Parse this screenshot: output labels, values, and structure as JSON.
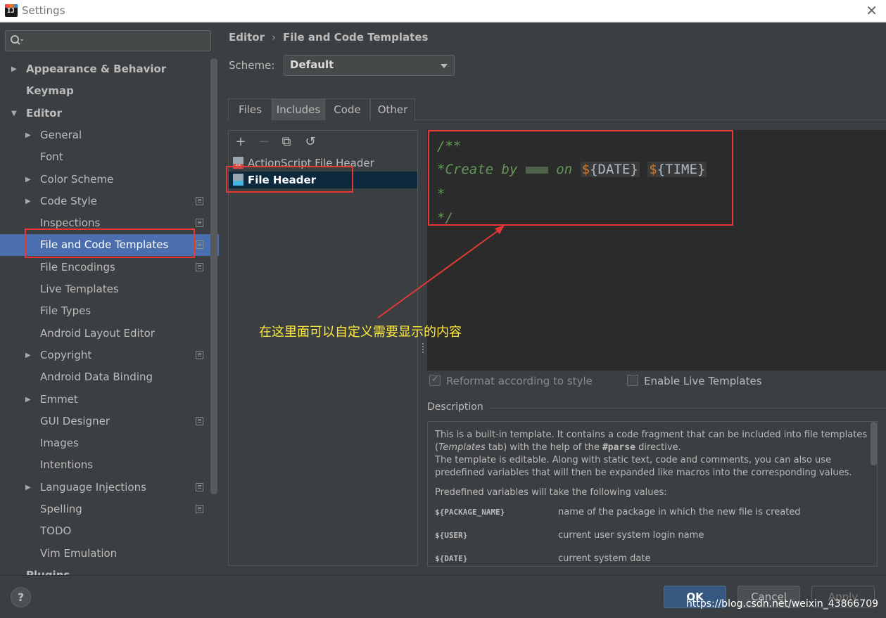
{
  "window": {
    "title": "Settings",
    "close": "✕"
  },
  "sidebar": {
    "search_placeholder": "",
    "items": [
      {
        "label": "Appearance & Behavior",
        "level": 0,
        "bold": true,
        "arrow": "▶"
      },
      {
        "label": "Keymap",
        "level": 0,
        "bold": true,
        "arrow": ""
      },
      {
        "label": "Editor",
        "level": 0,
        "bold": true,
        "arrow": "▼"
      },
      {
        "label": "General",
        "level": 1,
        "arrow": "▶"
      },
      {
        "label": "Font",
        "level": 1,
        "arrow": ""
      },
      {
        "label": "Color Scheme",
        "level": 1,
        "arrow": "▶"
      },
      {
        "label": "Code Style",
        "level": 1,
        "arrow": "▶",
        "project": true
      },
      {
        "label": "Inspections",
        "level": 1,
        "arrow": "",
        "project": true
      },
      {
        "label": "File and Code Templates",
        "level": 1,
        "arrow": "",
        "project": true,
        "selected": true
      },
      {
        "label": "File Encodings",
        "level": 1,
        "arrow": "",
        "project": true
      },
      {
        "label": "Live Templates",
        "level": 1,
        "arrow": ""
      },
      {
        "label": "File Types",
        "level": 1,
        "arrow": ""
      },
      {
        "label": "Android Layout Editor",
        "level": 1,
        "arrow": ""
      },
      {
        "label": "Copyright",
        "level": 1,
        "arrow": "▶",
        "project": true
      },
      {
        "label": "Android Data Binding",
        "level": 1,
        "arrow": ""
      },
      {
        "label": "Emmet",
        "level": 1,
        "arrow": "▶"
      },
      {
        "label": "GUI Designer",
        "level": 1,
        "arrow": "",
        "project": true
      },
      {
        "label": "Images",
        "level": 1,
        "arrow": ""
      },
      {
        "label": "Intentions",
        "level": 1,
        "arrow": ""
      },
      {
        "label": "Language Injections",
        "level": 1,
        "arrow": "▶",
        "project": true
      },
      {
        "label": "Spelling",
        "level": 1,
        "arrow": "",
        "project": true
      },
      {
        "label": "TODO",
        "level": 1,
        "arrow": ""
      },
      {
        "label": "Vim Emulation",
        "level": 1,
        "arrow": ""
      },
      {
        "label": "Plugins",
        "level": 0,
        "bold": true,
        "arrow": ""
      }
    ]
  },
  "breadcrumb": {
    "parent": "Editor",
    "separator": "›",
    "current": "File and Code Templates"
  },
  "scheme": {
    "label": "Scheme:",
    "value": "Default"
  },
  "tabs": [
    {
      "label": "Files",
      "active": false
    },
    {
      "label": "Includes",
      "active": true
    },
    {
      "label": "Code",
      "active": false
    },
    {
      "label": "Other",
      "active": false
    }
  ],
  "toolbar": {
    "add": "+",
    "remove": "−",
    "copy": "⧉",
    "reset": "↺"
  },
  "templates": [
    {
      "label": "ActionScript File Header",
      "icon": "actionscript-file-icon",
      "selected": false
    },
    {
      "label": "File Header",
      "icon": "file-header-icon",
      "selected": true
    }
  ],
  "editor": {
    "line1": "/**",
    "line2_prefix": "*Create by",
    "line2_on": "on",
    "var_date": "DATE",
    "var_time": "TIME",
    "line3": "*",
    "line4": "*/"
  },
  "options": {
    "reformat": "Reformat according to style",
    "live_templates": "Enable Live Templates"
  },
  "description": {
    "title": "Description",
    "p1a": "This is a built-in template. It contains a code fragment that can be included into file templates (",
    "p1_italic": "Templates",
    "p1b": " tab) with the help of the ",
    "p1_code": "#parse",
    "p1c": " directive.",
    "p2": "The template is editable. Along with static text, code and comments, you can also use predefined variables that will then be expanded like macros into the corresponding values.",
    "p3": "Predefined variables will take the following values:",
    "vars": [
      {
        "name": "${PACKAGE_NAME}",
        "desc": "name of the package in which the new file is created"
      },
      {
        "name": "${USER}",
        "desc": "current user system login name"
      },
      {
        "name": "${DATE}",
        "desc": "current system date"
      }
    ]
  },
  "footer": {
    "help": "?",
    "ok": "OK",
    "cancel": "Cancel",
    "apply": "Apply",
    "watermark": "https://blog.csdn.net/weixin_43866709"
  },
  "annotation": {
    "text": "在这里面可以自定义需要显示的内容",
    "color": "#e53935"
  }
}
